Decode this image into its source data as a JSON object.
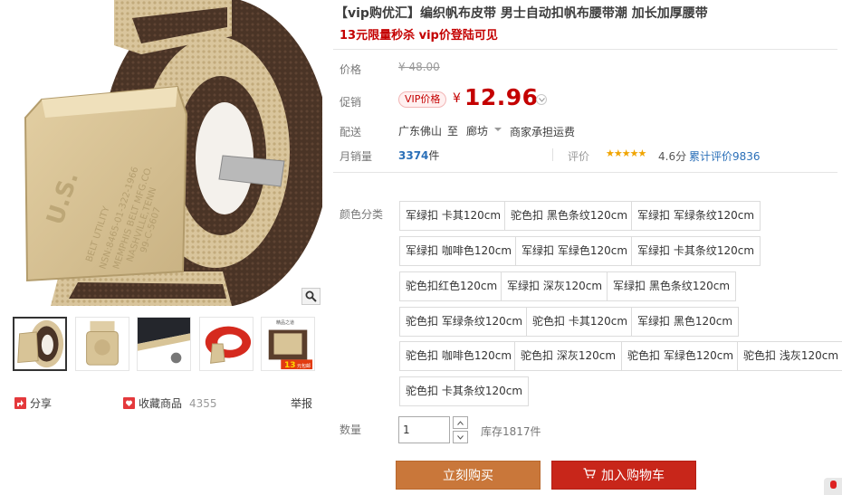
{
  "product": {
    "title": "【vip购优汇】编织帆布皮带 男士自动扣帆布腰带潮 加长加厚腰带",
    "subtitle": "13元限量秒杀 vip价登陆可见"
  },
  "gallery": {
    "main_image": "khaki-and-brown-canvas-belt-with-us-buckle",
    "thumbnails": [
      "belt-khaki-brown-roll",
      "belt-khaki-buckle-front",
      "belt-dark-lining-detail",
      "belt-red-strap",
      "belt-box-promo"
    ],
    "thumb_promo_text": "13",
    "thumb_promo_suffix": "元包邮",
    "thumb_promo_header": "精品之道",
    "buckle_text": "U.S.",
    "buckle_engraving": [
      "BELT UTILITY",
      "NSN:8465-01-322-1966",
      "MEMPHIS BELT MFG.CO.",
      "NASHVILLE,TENN",
      "99-C-5607"
    ],
    "zoom_icon": "magnifier-icon"
  },
  "actions": {
    "share_label": "分享",
    "favorite_label": "收藏商品",
    "favorite_count": "4355",
    "report_label": "举报"
  },
  "price": {
    "orig_label": "价格",
    "orig_value": "¥ 48.00",
    "promo_label": "促销",
    "vip_badge": "VIP价格",
    "currency": "¥",
    "current": "12.96"
  },
  "shipping": {
    "label": "配送",
    "from": "广东佛山",
    "to_word": "至",
    "city": "廊坊",
    "fee": "商家承担运费"
  },
  "sales": {
    "label": "月销量",
    "count": "3374",
    "unit": "件",
    "rating_label": "评价",
    "stars": "★★★★★",
    "score": "4.6分",
    "total_reviews": "累计评价9836"
  },
  "sku": {
    "label": "颜色分类",
    "options": [
      "军绿扣 卡其120cm",
      "驼色扣 黑色条纹120cm",
      "军绿扣 军绿条纹120cm",
      "军绿扣 咖啡色120cm",
      "军绿扣 军绿色120cm",
      "军绿扣 卡其条纹120cm",
      "驼色扣红色120cm",
      "军绿扣 深灰120cm",
      "军绿扣 黑色条纹120cm",
      "驼色扣 军绿条纹120cm",
      "驼色扣 卡其120cm",
      "军绿扣 黑色120cm",
      "驼色扣 咖啡色120cm",
      "驼色扣 深灰120cm",
      "驼色扣 军绿色120cm",
      "驼色扣 浅灰120cm",
      "驼色扣 卡其条纹120cm"
    ]
  },
  "quantity": {
    "label": "数量",
    "value": "1",
    "stock": "库存1817件"
  },
  "buttons": {
    "buy_now": "立刻购买",
    "add_to_cart": "加入购物车"
  },
  "colors": {
    "price_red": "#c40000",
    "buy_orange": "#c9773a",
    "cart_red": "#c8261a",
    "link_blue": "#2a6fb8",
    "star_gold": "#f0a400"
  }
}
